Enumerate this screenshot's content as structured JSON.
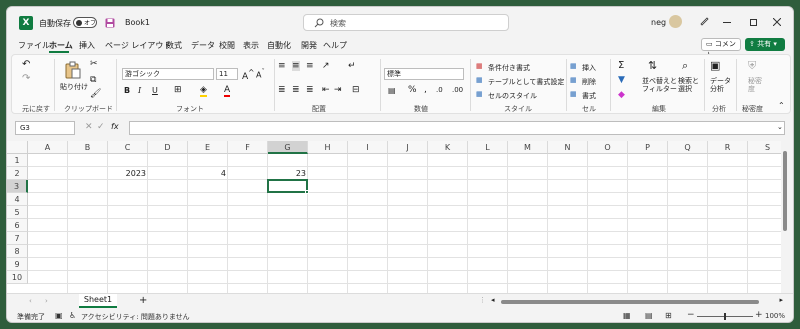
{
  "titlebar": {
    "autosave_label": "自動保存",
    "autosave_state": "オフ",
    "filename": "Book1",
    "search_placeholder": "検索",
    "user": "neg"
  },
  "tabs": [
    "ファイル",
    "ホーム",
    "挿入",
    "ページ レイアウト",
    "数式",
    "データ",
    "校閲",
    "表示",
    "自動化",
    "開発",
    "ヘルプ"
  ],
  "active_tab": "ホーム",
  "comments_label": "コメント",
  "share_label": "共有",
  "ribbon": {
    "undo_group": "元に戻す",
    "clipboard": {
      "paste": "貼り付け",
      "group": "クリップボード"
    },
    "font": {
      "name": "游ゴシック",
      "size": "11",
      "group": "フォント"
    },
    "alignment": {
      "group": "配置"
    },
    "number": {
      "format": "標準",
      "group": "数値"
    },
    "styles": {
      "conditional": "条件付き書式",
      "table": "テーブルとして書式設定",
      "cell": "セルのスタイル",
      "group": "スタイル"
    },
    "cells": {
      "insert": "挿入",
      "delete": "削除",
      "format": "書式",
      "group": "セル"
    },
    "editing": {
      "sort": "並べ替えと\nフィルター",
      "find": "検索と\n選択",
      "group": "編集"
    },
    "analysis": {
      "data": "データ\n分析",
      "group": "分析"
    },
    "sensitivity": {
      "label": "秘密\n度",
      "group": "秘密度"
    }
  },
  "formula_bar": {
    "name_box": "G3",
    "fx": "fx",
    "content": ""
  },
  "columns": [
    "A",
    "B",
    "C",
    "D",
    "E",
    "F",
    "G",
    "H",
    "I",
    "J",
    "K",
    "L",
    "M",
    "N",
    "O",
    "P",
    "Q",
    "R",
    "S"
  ],
  "rows": [
    "1",
    "2",
    "3",
    "4",
    "5",
    "6",
    "7",
    "8",
    "9",
    "10"
  ],
  "cells": [
    {
      "ref": "C2",
      "value": "2023"
    },
    {
      "ref": "E2",
      "value": "4"
    },
    {
      "ref": "G2",
      "value": "23"
    }
  ],
  "selected_cell": "G3",
  "sheets": [
    "Sheet1"
  ],
  "status": {
    "ready": "準備完了",
    "accessibility": "アクセシビリティ: 問題ありません",
    "zoom": "100%"
  },
  "colors": {
    "excel_green": "#107c41",
    "selection": "#217346"
  }
}
